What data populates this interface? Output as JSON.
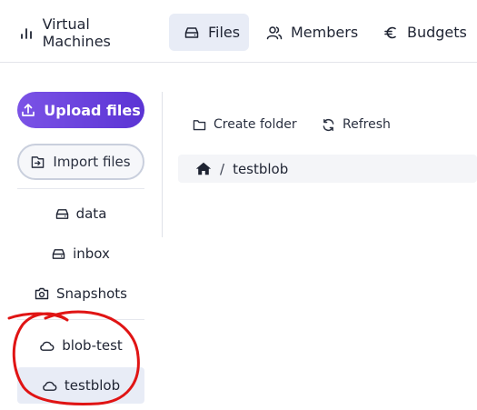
{
  "nav": {
    "tabs": [
      {
        "label": "Virtual Machines",
        "icon": "bar-chart-icon"
      },
      {
        "label": "Files",
        "icon": "drive-icon",
        "active": true
      },
      {
        "label": "Members",
        "icon": "users-icon"
      },
      {
        "label": "Budgets",
        "icon": "euro-icon"
      }
    ]
  },
  "sidebar": {
    "upload_label": "Upload files",
    "import_label": "Import files",
    "items": [
      {
        "label": "data",
        "icon": "drive-icon"
      },
      {
        "label": "inbox",
        "icon": "drive-icon"
      },
      {
        "label": "Snapshots",
        "icon": "snapshot-icon"
      },
      {
        "label": "blob-test",
        "icon": "cloud-icon"
      },
      {
        "label": "testblob",
        "icon": "cloud-icon",
        "active": true
      }
    ]
  },
  "toolbar": {
    "create_folder_label": "Create folder",
    "refresh_label": "Refresh"
  },
  "breadcrumb": {
    "separator": "/",
    "current": "testblob"
  },
  "colors": {
    "accent": "#6a43de",
    "active_bg": "#e8ecf6",
    "annotation": "#e01414"
  }
}
